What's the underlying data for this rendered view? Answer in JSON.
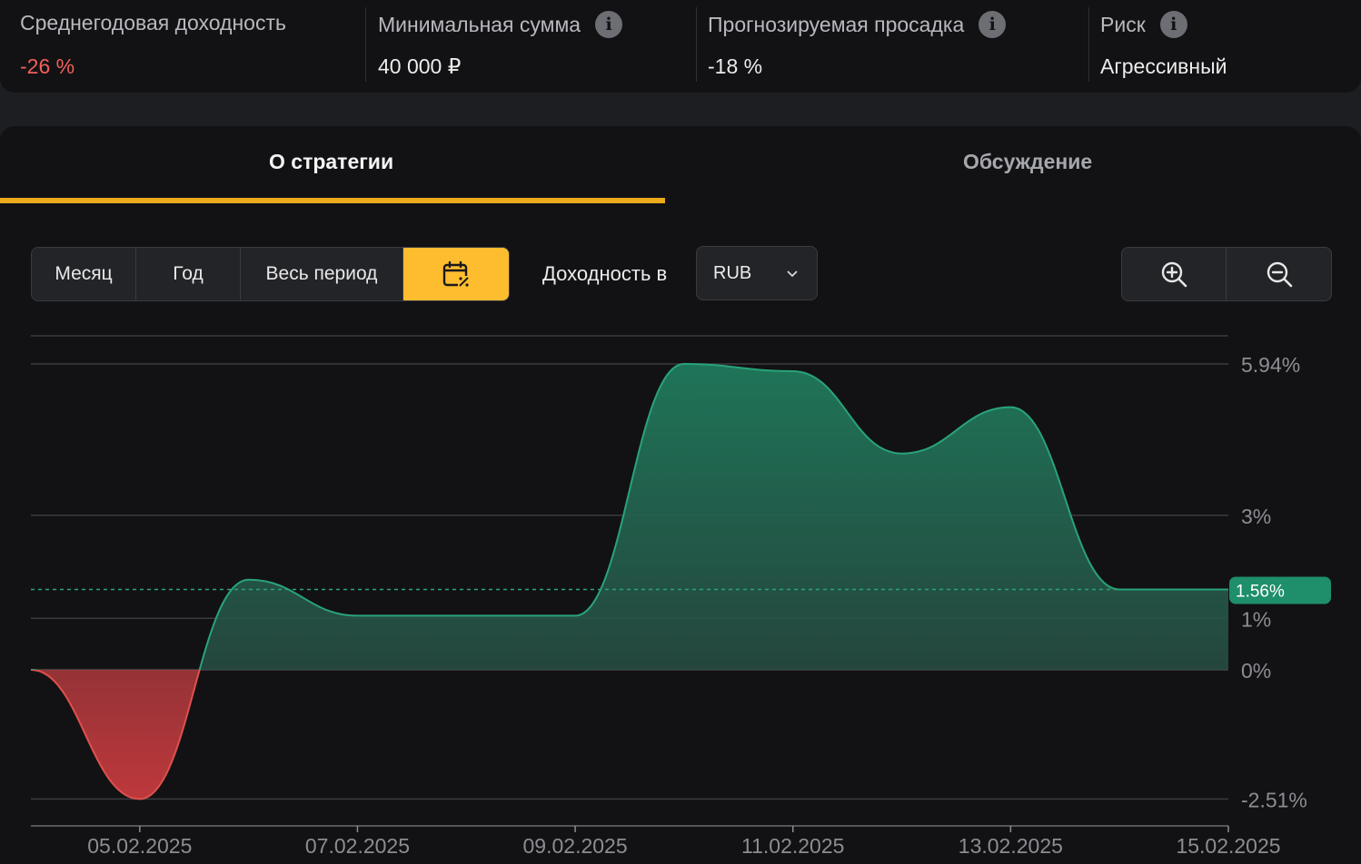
{
  "stats": [
    {
      "label": "Среднегодовая доходность",
      "value": "-26 %",
      "has_info": false,
      "value_color": "#f0605a"
    },
    {
      "label": "Минимальная сумма",
      "value": "40 000 ₽",
      "has_info": true
    },
    {
      "label": "Прогнозируемая просадка",
      "value": "-18 %",
      "has_info": true
    },
    {
      "label": "Риск",
      "value": "Агрессивный",
      "has_info": true
    }
  ],
  "info_icon_glyph": "i",
  "tabs": [
    {
      "label": "О стратегии",
      "active": true
    },
    {
      "label": "Обсуждение",
      "active": false
    }
  ],
  "period": {
    "buttons": [
      "Месяц",
      "Год",
      "Весь период"
    ],
    "calendar_icon": "calendar-percent-icon",
    "active": "calendar"
  },
  "yield_label": "Доходность в",
  "currency": {
    "selected": "RUB",
    "icon": "chevron-down-icon"
  },
  "zoom": {
    "in_icon": "zoom-in-icon",
    "out_icon": "zoom-out-icon"
  },
  "colors": {
    "accent": "#ecaa1c",
    "positive": "#1e8f6a",
    "negative": "#e0504c",
    "current_badge": "#1e8f6a"
  },
  "chart_data": {
    "type": "area",
    "x_ticks": [
      "05.02.2025",
      "07.02.2025",
      "09.02.2025",
      "11.02.2025",
      "13.02.2025",
      "15.02.2025"
    ],
    "y_ticks": [
      {
        "value": 5.94,
        "label": "5.94%"
      },
      {
        "value": 3,
        "label": "3%"
      },
      {
        "value": 1,
        "label": "1%"
      },
      {
        "value": 0,
        "label": "0%"
      },
      {
        "value": -2.51,
        "label": "-2.51%"
      }
    ],
    "current_value": {
      "value": 1.56,
      "label": "1.56%"
    },
    "ylim": [
      -3.0,
      6.5
    ],
    "xlim": [
      "04.02.2025",
      "15.02.2025"
    ],
    "series": [
      {
        "x": [
          "04.02.2025",
          "05.02.2025",
          "06.02.2025",
          "07.02.2025",
          "08.02.2025",
          "09.02.2025",
          "10.02.2025",
          "11.02.2025",
          "12.02.2025",
          "13.02.2025",
          "14.02.2025",
          "15.02.2025"
        ],
        "y": [
          0,
          -2.51,
          1.75,
          1.05,
          1.05,
          1.05,
          5.94,
          5.8,
          4.2,
          5.1,
          1.56,
          1.56
        ]
      }
    ]
  }
}
